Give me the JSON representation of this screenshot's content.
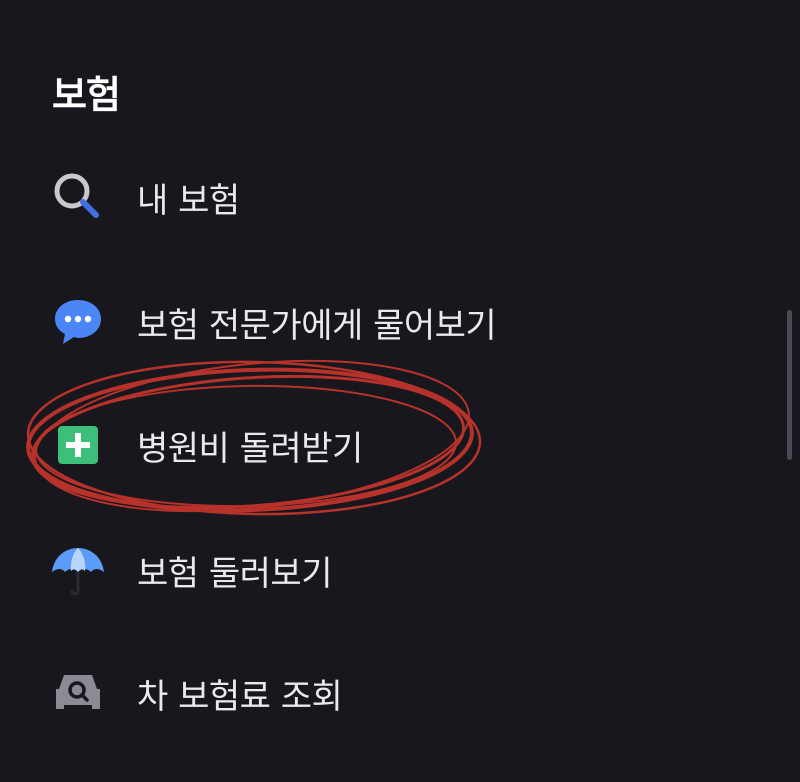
{
  "section": {
    "title": "보험"
  },
  "menu": {
    "items": [
      {
        "label": "내 보험",
        "icon": "search-icon"
      },
      {
        "label": "보험 전문가에게 물어보기",
        "icon": "chat-bubble-icon"
      },
      {
        "label": "병원비 돌려받기",
        "icon": "plus-square-icon"
      },
      {
        "label": "보험 둘러보기",
        "icon": "umbrella-icon"
      },
      {
        "label": "차 보험료 조회",
        "icon": "car-search-icon"
      }
    ]
  },
  "colors": {
    "background": "#18171d",
    "text": "#e9e9ee",
    "chat_blue": "#4a86f5",
    "plus_green": "#3cbf78",
    "umbrella_blue": "#5b9df6",
    "annotation_red": "#c8352c"
  }
}
